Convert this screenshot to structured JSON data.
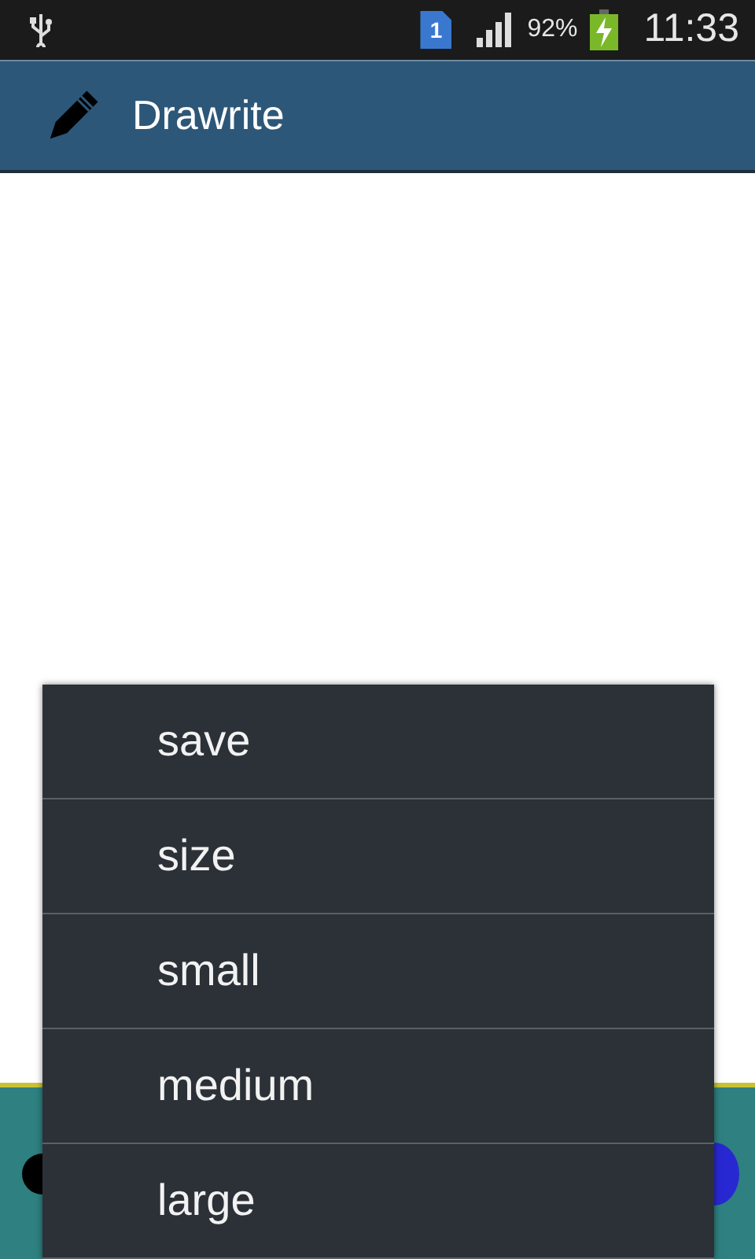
{
  "status_bar": {
    "battery": "92%",
    "time": "11:33",
    "notification": "1"
  },
  "app_bar": {
    "title": "Drawrite"
  },
  "palette": {
    "swatches": [
      {
        "color": "#000000"
      },
      {
        "color": "#2828d2"
      }
    ]
  },
  "menu": {
    "items": [
      {
        "label": "save"
      },
      {
        "label": "size"
      },
      {
        "label": "small"
      },
      {
        "label": "medium"
      },
      {
        "label": "large"
      }
    ]
  }
}
